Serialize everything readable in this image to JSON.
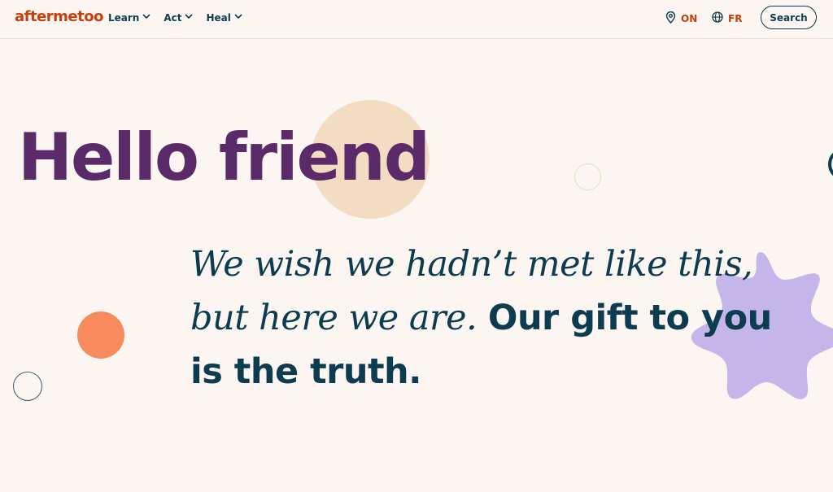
{
  "brand": {
    "logo_text": "aftermetoo",
    "logo_color": "#c2410c"
  },
  "nav": {
    "items": [
      {
        "label": "Learn",
        "icon": "chevron-down-icon"
      },
      {
        "label": "Act",
        "icon": "chevron-down-icon"
      },
      {
        "label": "Heal",
        "icon": "chevron-down-icon"
      }
    ]
  },
  "header": {
    "region_label": "ON",
    "region_icon": "location-pin-icon",
    "language_label": "FR",
    "language_icon": "globe-icon",
    "search_label": "Search"
  },
  "hero": {
    "title": "Hello friend",
    "subtitle_italic_line1": "We wish we hadn’t met like this,",
    "subtitle_italic_line2": "but here we are.",
    "subtitle_bold": "Our gift to you is the truth."
  },
  "colors": {
    "background": "#fbf6f1",
    "title": "#5b2a68",
    "text": "#0d3b4f",
    "accent": "#c2410c",
    "beige_circle": "#f2ddc2",
    "orange_circle": "#f78b5e",
    "lavender_star": "#c5b6ea"
  }
}
